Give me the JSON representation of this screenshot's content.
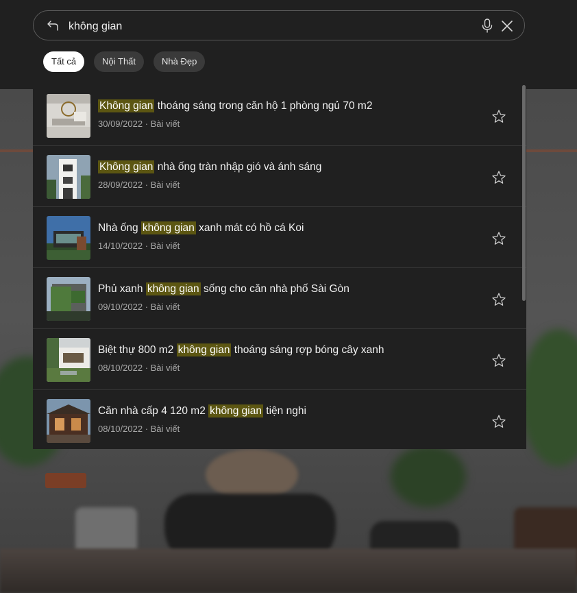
{
  "search": {
    "value": "không gian",
    "placeholder": ""
  },
  "filters": [
    {
      "label": "Tất cả",
      "active": true
    },
    {
      "label": "Nội Thất",
      "active": false
    },
    {
      "label": "Nhà Đẹp",
      "active": false
    }
  ],
  "results": [
    {
      "pre": "",
      "highlight": "Không gian",
      "post": " thoáng sáng trong căn hộ 1 phòng ngủ 70 m2",
      "date": "30/09/2022",
      "type": "Bài viết"
    },
    {
      "pre": "",
      "highlight": "Không gian",
      "post": " nhà ống tràn nhập gió và ánh sáng",
      "date": "28/09/2022",
      "type": "Bài viết"
    },
    {
      "pre": "Nhà ống ",
      "highlight": "không gian",
      "post": " xanh mát có hồ cá Koi",
      "date": "14/10/2022",
      "type": "Bài viết"
    },
    {
      "pre": "Phủ xanh ",
      "highlight": "không gian",
      "post": " sống cho căn nhà phố Sài Gòn",
      "date": "09/10/2022",
      "type": "Bài viết"
    },
    {
      "pre": "Biệt thự 800 m2 ",
      "highlight": "không gian",
      "post": " thoáng sáng rợp bóng cây xanh",
      "date": "08/10/2022",
      "type": "Bài viết"
    },
    {
      "pre": "Căn nhà cấp 4 120 m2 ",
      "highlight": "không gian",
      "post": " tiện nghi",
      "date": "08/10/2022",
      "type": "Bài viết"
    }
  ],
  "meta_separator": " · ",
  "colors": {
    "highlight_bg": "#5c5612",
    "panel_bg": "#202020",
    "chip_active_bg": "#ffffff"
  },
  "icons": [
    "back-arrow-icon",
    "microphone-icon",
    "close-icon",
    "star-outline-icon"
  ]
}
